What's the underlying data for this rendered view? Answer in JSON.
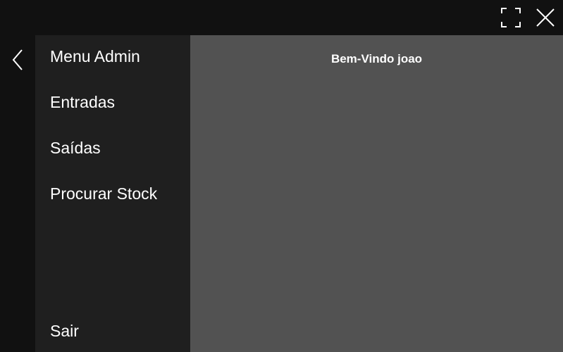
{
  "window": {
    "fullscreen_icon": "fullscreen-icon",
    "close_icon": "close-icon",
    "back_icon": "chevron-left-icon"
  },
  "sidebar": {
    "items": [
      {
        "label": "Menu Admin"
      },
      {
        "label": "Entradas"
      },
      {
        "label": "Saídas"
      },
      {
        "label": "Procurar Stock"
      }
    ],
    "exit_label": "Sair"
  },
  "main": {
    "welcome": "Bem-Vindo joao"
  },
  "colors": {
    "frame": "#111111",
    "sidebar": "#1f1f1f",
    "content": "#525252",
    "text": "#ffffff"
  }
}
